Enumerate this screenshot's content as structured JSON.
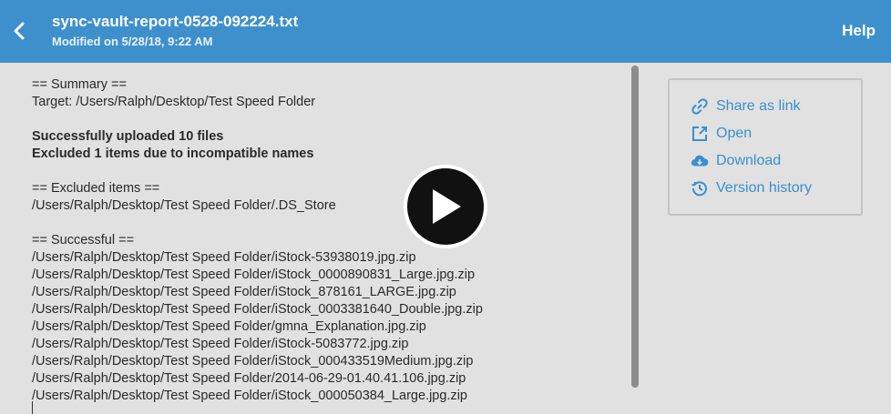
{
  "header": {
    "title": "sync-vault-report-0528-092224.txt",
    "subtitle": "Modified on 5/28/18, 9:22 AM",
    "help_label": "Help",
    "back_icon": "chevron-left-icon"
  },
  "document": {
    "lines": [
      {
        "text": "== Summary ==",
        "bold": false
      },
      {
        "text": "Target: /Users/Ralph/Desktop/Test Speed Folder",
        "bold": false
      },
      {
        "text": "",
        "bold": false
      },
      {
        "text": "Successfully uploaded 10 files",
        "bold": true
      },
      {
        "text": "Excluded 1 items due to incompatible names",
        "bold": true
      },
      {
        "text": "",
        "bold": false
      },
      {
        "text": "== Excluded items ==",
        "bold": false
      },
      {
        "text": "/Users/Ralph/Desktop/Test Speed Folder/.DS_Store",
        "bold": false
      },
      {
        "text": "",
        "bold": false
      },
      {
        "text": "== Successful ==",
        "bold": false
      },
      {
        "text": "/Users/Ralph/Desktop/Test Speed Folder/iStock-53938019.jpg.zip",
        "bold": false
      },
      {
        "text": "/Users/Ralph/Desktop/Test Speed Folder/iStock_0000890831_Large.jpg.zip",
        "bold": false
      },
      {
        "text": "/Users/Ralph/Desktop/Test Speed Folder/iStock_878161_LARGE.jpg.zip",
        "bold": false
      },
      {
        "text": "/Users/Ralph/Desktop/Test Speed Folder/iStock_0003381640_Double.jpg.zip",
        "bold": false
      },
      {
        "text": "/Users/Ralph/Desktop/Test Speed Folder/gmna_Explanation.jpg.zip",
        "bold": false
      },
      {
        "text": "/Users/Ralph/Desktop/Test Speed Folder/iStock-5083772.jpg.zip",
        "bold": false
      },
      {
        "text": "/Users/Ralph/Desktop/Test Speed Folder/iStock_000433519Medium.jpg.zip",
        "bold": false
      },
      {
        "text": "/Users/Ralph/Desktop/Test Speed Folder/2014-06-29-01.40.41.106.jpg.zip",
        "bold": false
      },
      {
        "text": "/Users/Ralph/Desktop/Test Speed Folder/iStock_000050384_Large.jpg.zip",
        "bold": false
      }
    ]
  },
  "overlay": {
    "play_icon": "play-icon"
  },
  "actions": {
    "items": [
      {
        "label": "Share as link",
        "icon": "link-icon"
      },
      {
        "label": "Open",
        "icon": "external-open-icon"
      },
      {
        "label": "Download",
        "icon": "cloud-download-icon"
      },
      {
        "label": "Version history",
        "icon": "history-icon"
      }
    ]
  },
  "colors": {
    "header_bg": "#3e90cc",
    "accent": "#3a8fcf",
    "background": "#e1e1e1"
  }
}
